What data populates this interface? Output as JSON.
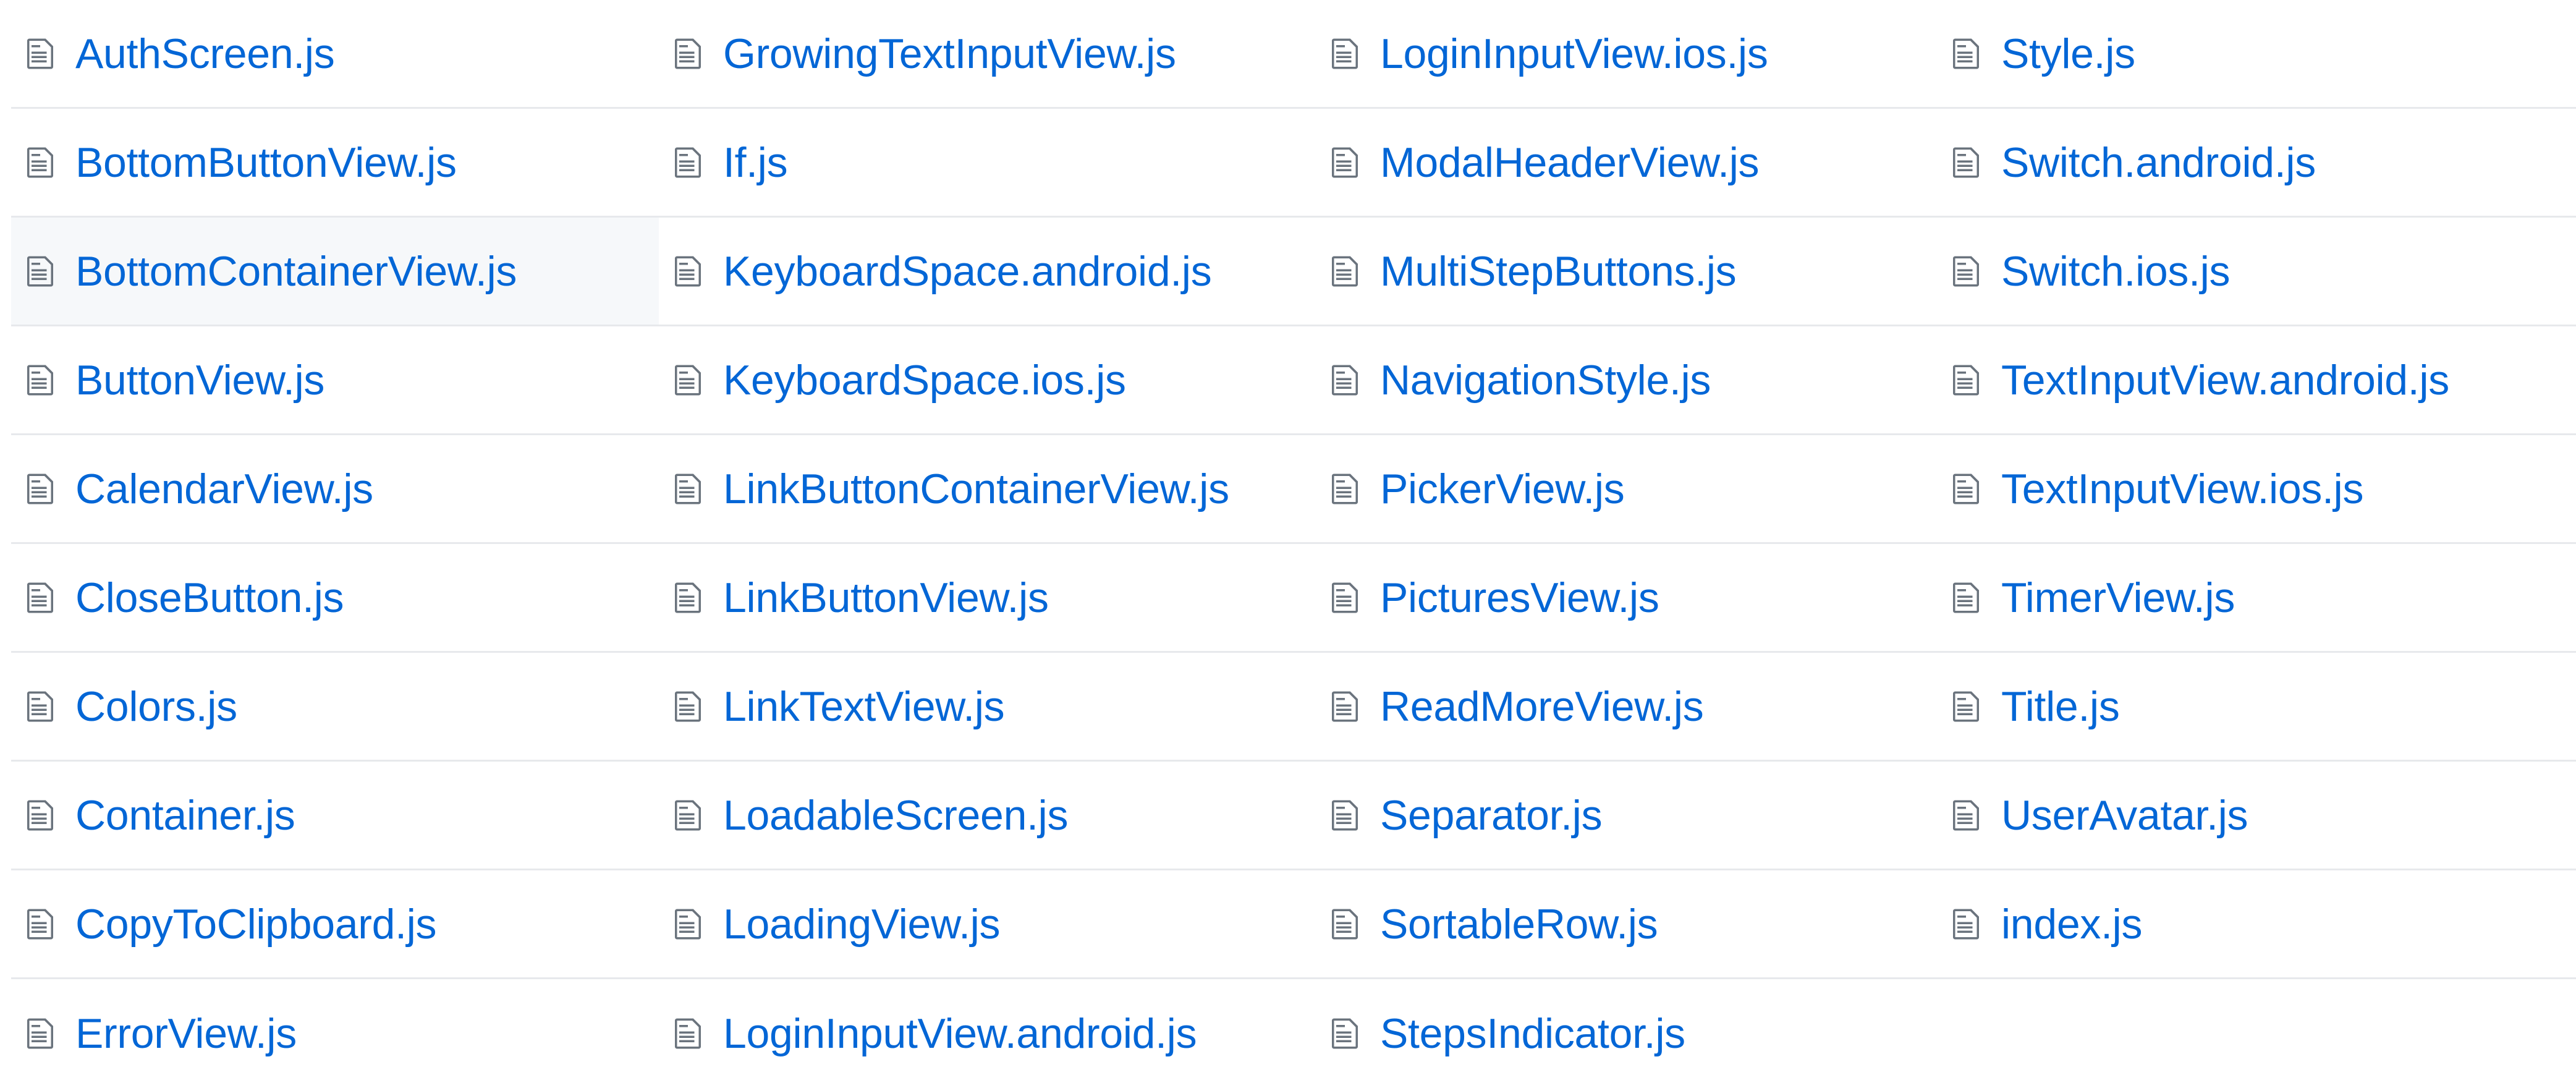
{
  "colors": {
    "link": "#0366d6",
    "icon": "#6a737d",
    "divider": "#e7e9ec",
    "hover_row": "#f6f8fa",
    "background": "#ffffff"
  },
  "icon": "file-text-icon",
  "hovered_file": "BottomContainerView.js",
  "columns": [
    [
      "AuthScreen.js",
      "BottomButtonView.js",
      "BottomContainerView.js",
      "ButtonView.js",
      "CalendarView.js",
      "CloseButton.js",
      "Colors.js",
      "Container.js",
      "CopyToClipboard.js",
      "ErrorView.js"
    ],
    [
      "GrowingTextInputView.js",
      "If.js",
      "KeyboardSpace.android.js",
      "KeyboardSpace.ios.js",
      "LinkButtonContainerView.js",
      "LinkButtonView.js",
      "LinkTextView.js",
      "LoadableScreen.js",
      "LoadingView.js",
      "LoginInputView.android.js"
    ],
    [
      "LoginInputView.ios.js",
      "ModalHeaderView.js",
      "MultiStepButtons.js",
      "NavigationStyle.js",
      "PickerView.js",
      "PicturesView.js",
      "ReadMoreView.js",
      "Separator.js",
      "SortableRow.js",
      "StepsIndicator.js"
    ],
    [
      "Style.js",
      "Switch.android.js",
      "Switch.ios.js",
      "TextInputView.android.js",
      "TextInputView.ios.js",
      "TimerView.js",
      "Title.js",
      "UserAvatar.js",
      "index.js"
    ]
  ]
}
